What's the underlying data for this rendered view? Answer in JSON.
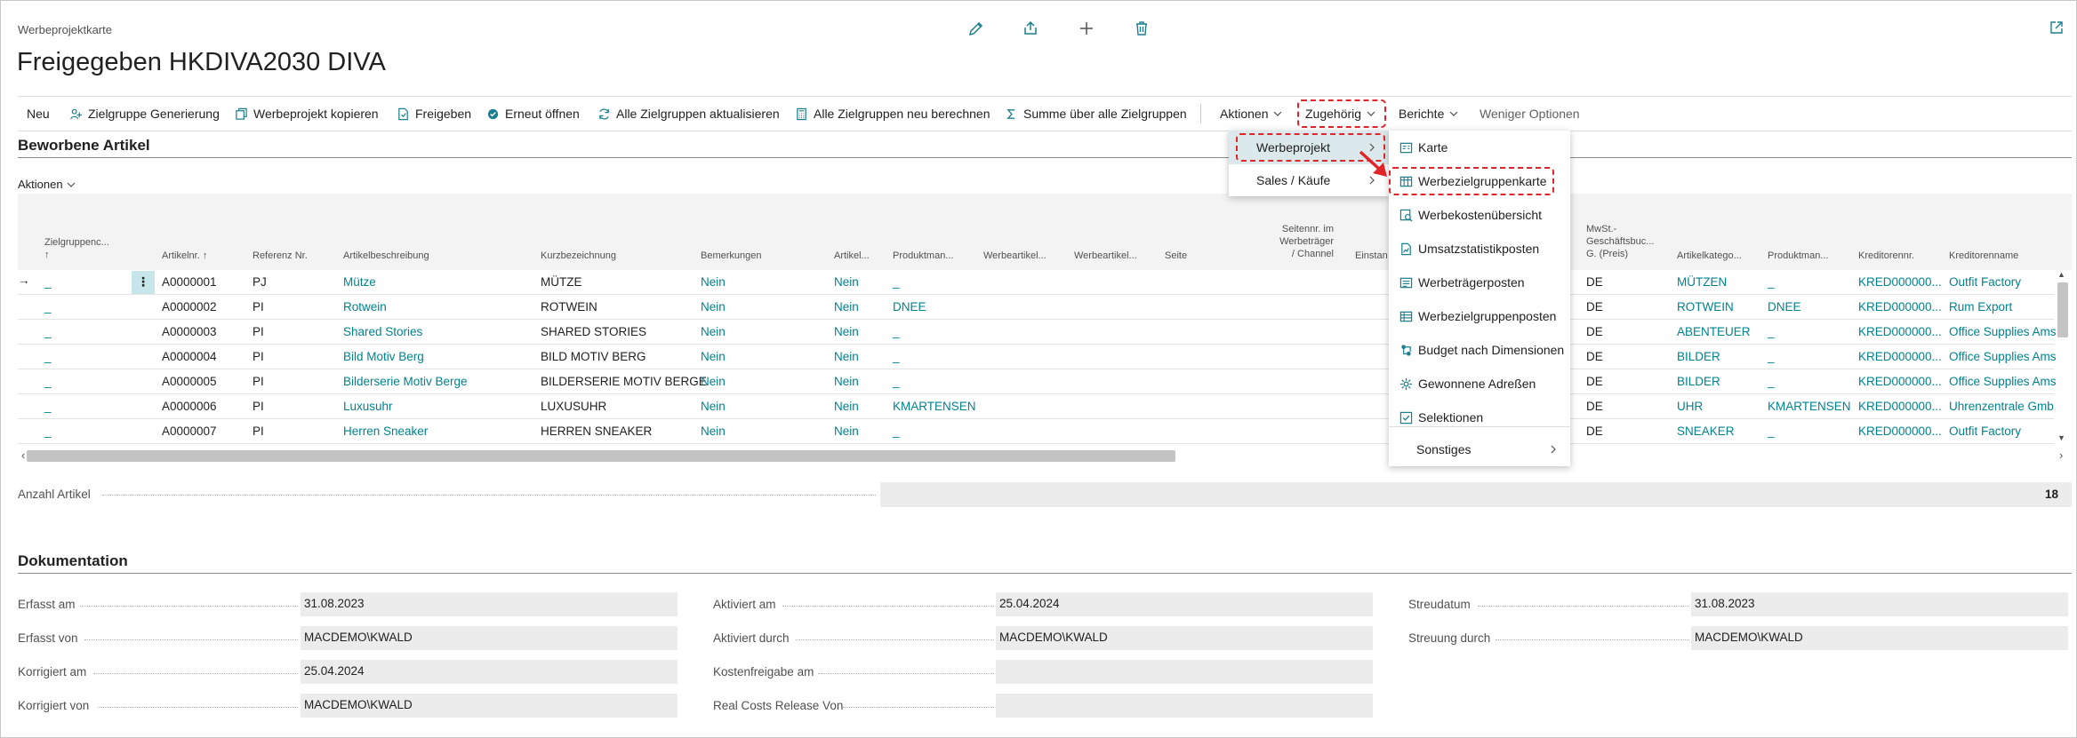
{
  "header": {
    "caption": "Werbeprojektkarte",
    "title": "Freigegeben HKDIVA2030 DIVA"
  },
  "toolbar": {
    "neu": "Neu",
    "zielgruppe_generierung": "Zielgruppe Generierung",
    "werbeprojekt_kopieren": "Werbeprojekt kopieren",
    "freigeben": "Freigeben",
    "erneut_oeffnen": "Erneut öffnen",
    "alle_zielgruppen_aktualisieren": "Alle Zielgruppen aktualisieren",
    "alle_zielgruppen_neu_berechnen": "Alle Zielgruppen neu berechnen",
    "summe_ueber_alle_zielgruppen": "Summe über alle Zielgruppen",
    "aktionen": "Aktionen",
    "zugehoerig": "Zugehörig",
    "berichte": "Berichte",
    "weniger_optionen": "Weniger Optionen"
  },
  "lines": {
    "section_title": "Beworbene Artikel",
    "actions_label": "Aktionen",
    "columns": {
      "zielgruppe": "Zielgruppenc...",
      "artikelnr": "Artikelnr. ↑",
      "referenz": "Referenz Nr.",
      "artikelbeschreibung": "Artikelbeschreibung",
      "kurzbezeichnung": "Kurzbezeichnung",
      "bemerkungen": "Bemerkungen",
      "artikel": "Artikel...",
      "produktman1": "Produktman...",
      "werbeartikel1": "Werbeartikel...",
      "werbeartikel2": "Werbeartikel...",
      "seite": "Seite",
      "seitennr_l1": "Seitennr. im",
      "seitennr_l2": "Werbeträger",
      "seitennr_l3": "/ Channel",
      "einstand": "Einstan",
      "mwst_l1": "MwSt.-",
      "mwst_l2": "Geschäftsbuc...",
      "mwst_l3": "G. (Preis)",
      "artikelkategorie": "Artikelkatego...",
      "produktman2": "Produktman...",
      "kreditorennr": "Kreditorennr.",
      "kreditorenname": "Kreditorenname"
    },
    "rows": [
      {
        "zielgruppe": "_",
        "artikelnr": "A0000001",
        "referenz": "PJ",
        "beschreibung": "Mütze",
        "kurz": "MÜTZE",
        "bemerkungen": "Nein",
        "artikel": "Nein",
        "produktman": "_",
        "mwst": "DE",
        "kategorie": "MÜTZEN",
        "produktman2": "_",
        "kreditorennr": "KRED000000...",
        "kreditorenname": "Outfit Factory"
      },
      {
        "zielgruppe": "_",
        "artikelnr": "A0000002",
        "referenz": "PI",
        "beschreibung": "Rotwein",
        "kurz": "ROTWEIN",
        "bemerkungen": "Nein",
        "artikel": "Nein",
        "produktman": "DNEE",
        "mwst": "DE",
        "kategorie": "ROTWEIN",
        "produktman2": "DNEE",
        "kreditorennr": "KRED000000...",
        "kreditorenname": "Rum Export"
      },
      {
        "zielgruppe": "_",
        "artikelnr": "A0000003",
        "referenz": "PI",
        "beschreibung": "Shared Stories",
        "kurz": "SHARED STORIES",
        "bemerkungen": "Nein",
        "artikel": "Nein",
        "produktman": "_",
        "mwst": "DE",
        "kategorie": "ABENTEUER",
        "produktman2": "_",
        "kreditorennr": "KRED000000...",
        "kreditorenname": "Office Supplies Ams"
      },
      {
        "zielgruppe": "_",
        "artikelnr": "A0000004",
        "referenz": "PI",
        "beschreibung": "Bild Motiv Berg",
        "kurz": "BILD MOTIV BERG",
        "bemerkungen": "Nein",
        "artikel": "Nein",
        "produktman": "_",
        "mwst": "DE",
        "kategorie": "BILDER",
        "produktman2": "_",
        "kreditorennr": "KRED000000...",
        "kreditorenname": "Office Supplies Ams"
      },
      {
        "zielgruppe": "_",
        "artikelnr": "A0000005",
        "referenz": "PI",
        "beschreibung": "Bilderserie Motiv Berge",
        "kurz": "BILDERSERIE MOTIV BERGE",
        "bemerkungen": "Nein",
        "artikel": "Nein",
        "produktman": "_",
        "mwst": "DE",
        "kategorie": "BILDER",
        "produktman2": "_",
        "kreditorennr": "KRED000000...",
        "kreditorenname": "Office Supplies Ams"
      },
      {
        "zielgruppe": "_",
        "artikelnr": "A0000006",
        "referenz": "PI",
        "beschreibung": "Luxusuhr",
        "kurz": "LUXUSUHR",
        "bemerkungen": "Nein",
        "artikel": "Nein",
        "produktman": "KMARTENSEN",
        "mwst": "DE",
        "kategorie": "UHR",
        "produktman2": "KMARTENSEN",
        "kreditorennr": "KRED000000...",
        "kreditorenname": "Uhrenzentrale Gmb"
      },
      {
        "zielgruppe": "_",
        "artikelnr": "A0000007",
        "referenz": "PI",
        "beschreibung": "Herren Sneaker",
        "kurz": "HERREN SNEAKER",
        "bemerkungen": "Nein",
        "artikel": "Nein",
        "produktman": "_",
        "mwst": "DE",
        "kategorie": "SNEAKER",
        "produktman2": "_",
        "kreditorennr": "KRED000000...",
        "kreditorenname": "Outfit Factory"
      }
    ],
    "count_label": "Anzahl Artikel",
    "count_value": "18"
  },
  "documentation": {
    "section_title": "Dokumentation",
    "erfasst_am_label": "Erfasst am",
    "erfasst_am": "31.08.2023",
    "erfasst_von_label": "Erfasst von",
    "erfasst_von": "MACDEMO\\KWALD",
    "korrigiert_am_label": "Korrigiert am",
    "korrigiert_am": "25.04.2024",
    "korrigiert_von_label": "Korrigiert von",
    "korrigiert_von": "MACDEMO\\KWALD",
    "aktiviert_am_label": "Aktiviert am",
    "aktiviert_am": "25.04.2024",
    "aktiviert_durch_label": "Aktiviert durch",
    "aktiviert_durch": "MACDEMO\\KWALD",
    "kostenfreigabe_am_label": "Kostenfreigabe am",
    "kostenfreigabe_am": "",
    "real_costs_label": "Real Costs Release Von",
    "real_costs": "",
    "streudatum_label": "Streudatum",
    "streudatum": "31.08.2023",
    "streuung_durch_label": "Streuung durch",
    "streuung_durch": "MACDEMO\\KWALD"
  },
  "menu_zugehoerig": {
    "werbeprojekt": "Werbeprojekt",
    "sales_kaeufe": "Sales / Käufe"
  },
  "menu_werbeprojekt": {
    "karte": "Karte",
    "werbezielgruppenkarte": "Werbezielgruppenkarte",
    "werbekostenuebersicht": "Werbekostenübersicht",
    "umsatzstatistikposten": "Umsatzstatistikposten",
    "werbetraegerposten": "Werbeträgerposten",
    "werbezielgruppenposten": "Werbezielgruppenposten",
    "budget_nach_dimensionen": "Budget nach Dimensionen",
    "gewonnene_adressen": "Gewonnene Adreßen",
    "selektionen": "Selektionen",
    "sonstiges": "Sonstiges"
  },
  "colors": {
    "accent": "#00838f",
    "highlight": "#e0252a"
  }
}
